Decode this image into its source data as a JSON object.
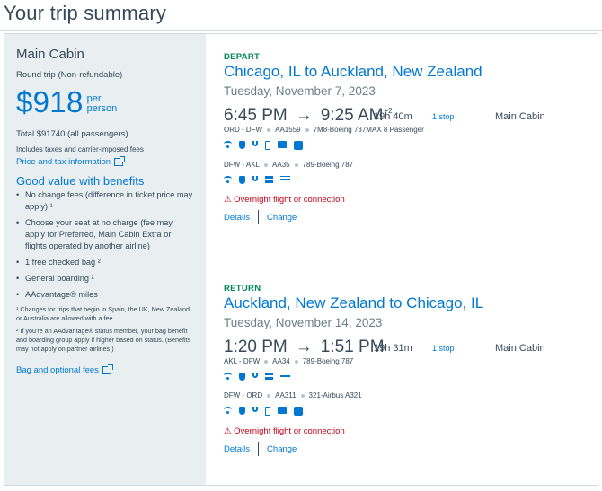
{
  "page": {
    "title": "Your trip summary"
  },
  "sidebar": {
    "cabin": "Main Cabin",
    "trip_type": "Round trip (Non-refundable)",
    "price": "$918",
    "per_1": "per",
    "per_2": "person",
    "total": "Total $91740 (all passengers)",
    "includes": "Includes taxes and carrier-imposed fees",
    "price_tax_link": "Price and tax information",
    "benefits_title": "Good value with benefits",
    "benefits": [
      "No change fees (difference in ticket price may apply) ¹",
      "Choose your seat at no charge (fee may apply for Preferred, Main Cabin Extra or flights operated by another airline)",
      "1 free checked bag ²",
      "General boarding ²",
      "AAdvantage® miles"
    ],
    "footnote_1": "¹ Changes for trips that begin in Spain, the UK, New Zealand or Australia are allowed with a fee.",
    "footnote_2": "² If you're an AAdvantage® status member, your bag benefit and boarding group apply if higher based on status. (Benefits may not apply on partner airlines.)",
    "bag_link": "Bag and optional fees"
  },
  "depart": {
    "label": "DEPART",
    "route": "Chicago, IL to Auckland, New Zealand",
    "date": "Tuesday, November 7, 2023",
    "dep_time": "6:45 PM",
    "arrow": "→",
    "arr_time": "9:25 AM",
    "plus_days": "+2",
    "duration": "19h 40m",
    "stops": "1 stop",
    "cabin": "Main Cabin",
    "seg1_route": "ORD - DFW",
    "seg1_flight": "AA1559",
    "seg1_aircraft": "7M8-Boeing 737MAX 8 Passenger",
    "seg2_route": "DFW - AKL",
    "seg2_flight": "AA35",
    "seg2_aircraft": "789-Boeing 787",
    "overnight": "⚠ Overnight flight or connection",
    "details": "Details",
    "change": "Change"
  },
  "return": {
    "label": "RETURN",
    "route": "Auckland, New Zealand to Chicago, IL",
    "date": "Tuesday, November 14, 2023",
    "dep_time": "1:20 PM",
    "arrow": "→",
    "arr_time": "1:51 PM",
    "duration": "19h 31m",
    "stops": "1 stop",
    "cabin": "Main Cabin",
    "seg1_route": "AKL - DFW",
    "seg1_flight": "AA34",
    "seg1_aircraft": "789-Boeing 787",
    "seg2_route": "DFW - ORD",
    "seg2_flight": "AA311",
    "seg2_aircraft": "321-Airbus A321",
    "overnight": "⚠ Overnight flight or connection",
    "details": "Details",
    "change": "Change"
  }
}
